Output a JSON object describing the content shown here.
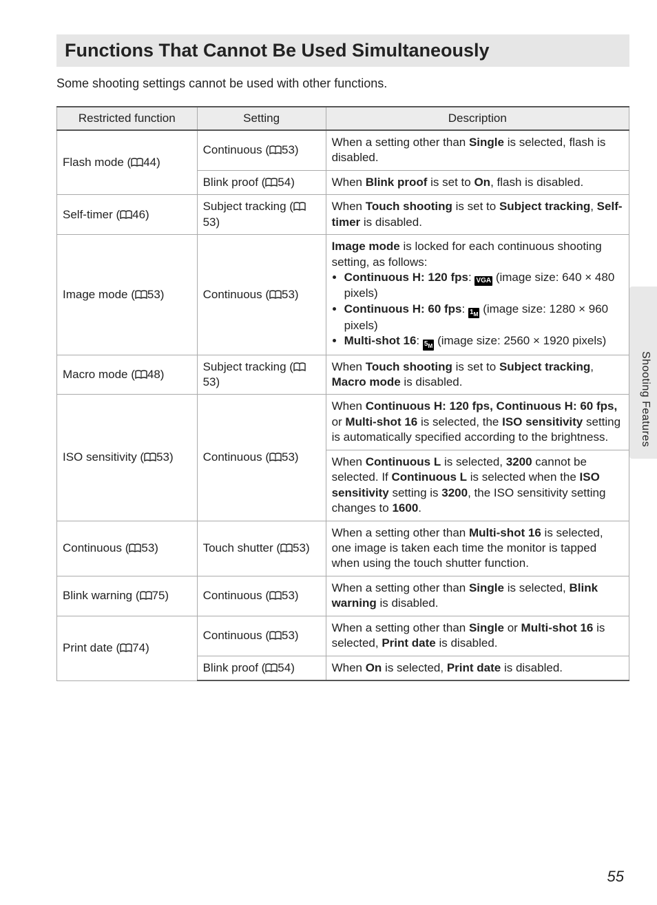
{
  "title": "Functions That Cannot Be Used Simultaneously",
  "intro": "Some shooting settings cannot be used with other functions.",
  "sideTab": "Shooting Features",
  "pageNumber": "55",
  "headers": {
    "restricted": "Restricted function",
    "setting": "Setting",
    "description": "Description"
  },
  "rows": [
    {
      "restricted": {
        "text": "Flash mode (",
        "ref": "44",
        "rowspan": 2
      },
      "setting": {
        "text": "Continuous (",
        "ref": "53"
      },
      "description": {
        "html": "When a setting other than <b>Single</b> is selected, flash is disabled."
      }
    },
    {
      "setting": {
        "text": "Blink proof (",
        "ref": "54"
      },
      "description": {
        "html": "When <b>Blink proof</b> is set to <b>On</b>, flash is disabled."
      }
    },
    {
      "restricted": {
        "text": "Self-timer (",
        "ref": "46"
      },
      "setting": {
        "text": "Subject tracking (",
        "ref": "53"
      },
      "description": {
        "html": "When <b>Touch shooting</b> is set to <b>Subject tracking</b>, <b>Self-timer</b> is disabled."
      }
    },
    {
      "restricted": {
        "text": "Image mode (",
        "ref": "53"
      },
      "setting": {
        "text": "Continuous (",
        "ref": "53"
      },
      "description": {
        "html": "<b>Image mode</b> is locked for each continuous shooting setting, as follows:<ul class='bullets'><li><b>Continuous H: 120 fps</b>: <span class='vga-icon' data-name='vga-icon'>VGA</span> (image size: 640 × 480 pixels)</li><li><b>Continuous H: 60 fps</b>: <span class='onem-icon' data-name='one-m-icon'>1<sub>M</sub></span> (image size: 1280 × 960 pixels)</li><li><b>Multi-shot 16</b>: <span class='fivem-icon' data-name='five-m-icon'>5<sub>M</sub></span> (image size: 2560 × 1920 pixels)</li></ul>"
      }
    },
    {
      "restricted": {
        "text": "Macro mode (",
        "ref": "48"
      },
      "setting": {
        "text": "Subject tracking (",
        "ref": "53"
      },
      "description": {
        "html": "When <b>Touch shooting</b> is set to <b>Subject tracking</b>, <b>Macro mode</b> is disabled."
      }
    },
    {
      "restricted": {
        "text": "ISO sensitivity (",
        "ref": "53",
        "rowspan": 2
      },
      "setting": {
        "text": "Continuous (",
        "ref": "53",
        "rowspan": 2
      },
      "description": {
        "html": "When <b>Continuous H: 120 fps, Continuous H: 60 fps,</b> or <b>Multi-shot 16</b> is selected, the <b>ISO sensitivity</b> setting is automatically specified according to the brightness."
      }
    },
    {
      "description": {
        "html": "When <b>Continuous L</b> is selected, <b>3200</b> cannot be selected. If <b>Continuous L</b> is selected when the <b>ISO sensitivity</b> setting is <b>3200</b>, the ISO sensitivity setting changes to <b>1600</b>."
      }
    },
    {
      "restricted": {
        "text": "Continuous (",
        "ref": "53"
      },
      "setting": {
        "text": "Touch shutter (",
        "ref": "53"
      },
      "description": {
        "html": "When a setting other than <b>Multi-shot 16</b> is selected, one image is taken each time the monitor is tapped when using the touch shutter function."
      }
    },
    {
      "restricted": {
        "text": "Blink warning (",
        "ref": "75"
      },
      "setting": {
        "text": "Continuous (",
        "ref": "53"
      },
      "description": {
        "html": "When a setting other than <b>Single</b> is selected, <b>Blink warning</b> is disabled."
      }
    },
    {
      "restricted": {
        "text": "Print date (",
        "ref": "74",
        "rowspan": 2
      },
      "setting": {
        "text": "Continuous (",
        "ref": "53"
      },
      "description": {
        "html": "When a setting other than <b>Single</b> or <b>Multi-shot 16</b> is selected, <b>Print date</b> is disabled."
      }
    },
    {
      "setting": {
        "text": "Blink proof (",
        "ref": "54"
      },
      "description": {
        "html": "When <b>On</b> is selected, <b>Print date</b> is disabled."
      },
      "last": true
    }
  ]
}
